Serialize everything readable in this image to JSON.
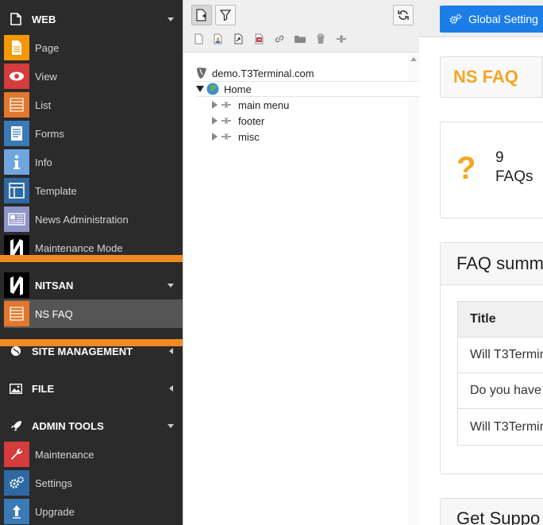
{
  "sidebar": {
    "web": {
      "label": "WEB",
      "items": [
        {
          "label": "Page"
        },
        {
          "label": "View"
        },
        {
          "label": "List"
        },
        {
          "label": "Forms"
        },
        {
          "label": "Info"
        },
        {
          "label": "Template"
        },
        {
          "label": "News Administration"
        },
        {
          "label": "Maintenance Mode"
        }
      ]
    },
    "nitsan": {
      "label": "NITSAN",
      "items": [
        {
          "label": "NS FAQ",
          "active": true
        }
      ]
    },
    "site_management": {
      "label": "SITE MANAGEMENT"
    },
    "file": {
      "label": "FILE"
    },
    "admin_tools": {
      "label": "ADMIN TOOLS",
      "items": [
        {
          "label": "Maintenance"
        },
        {
          "label": "Settings"
        },
        {
          "label": "Upgrade"
        }
      ]
    },
    "highlight_color": "#f08a24"
  },
  "page_tree": {
    "root": "demo.T3Terminal.com",
    "home": "Home",
    "children": [
      "main menu",
      "footer",
      "misc"
    ]
  },
  "content": {
    "global_setting_button": "Global Setting",
    "module_title": "NS FAQ",
    "stat_count": "9",
    "stat_label": "FAQs",
    "summary_title": "FAQ summ",
    "table_header": "Title",
    "table_rows": [
      "Will T3Termin",
      "Do you have c",
      "Will T3Termin"
    ],
    "support_title": "Get Suppo",
    "accent_color": "#f5a623",
    "button_color": "#1a7ee6"
  }
}
